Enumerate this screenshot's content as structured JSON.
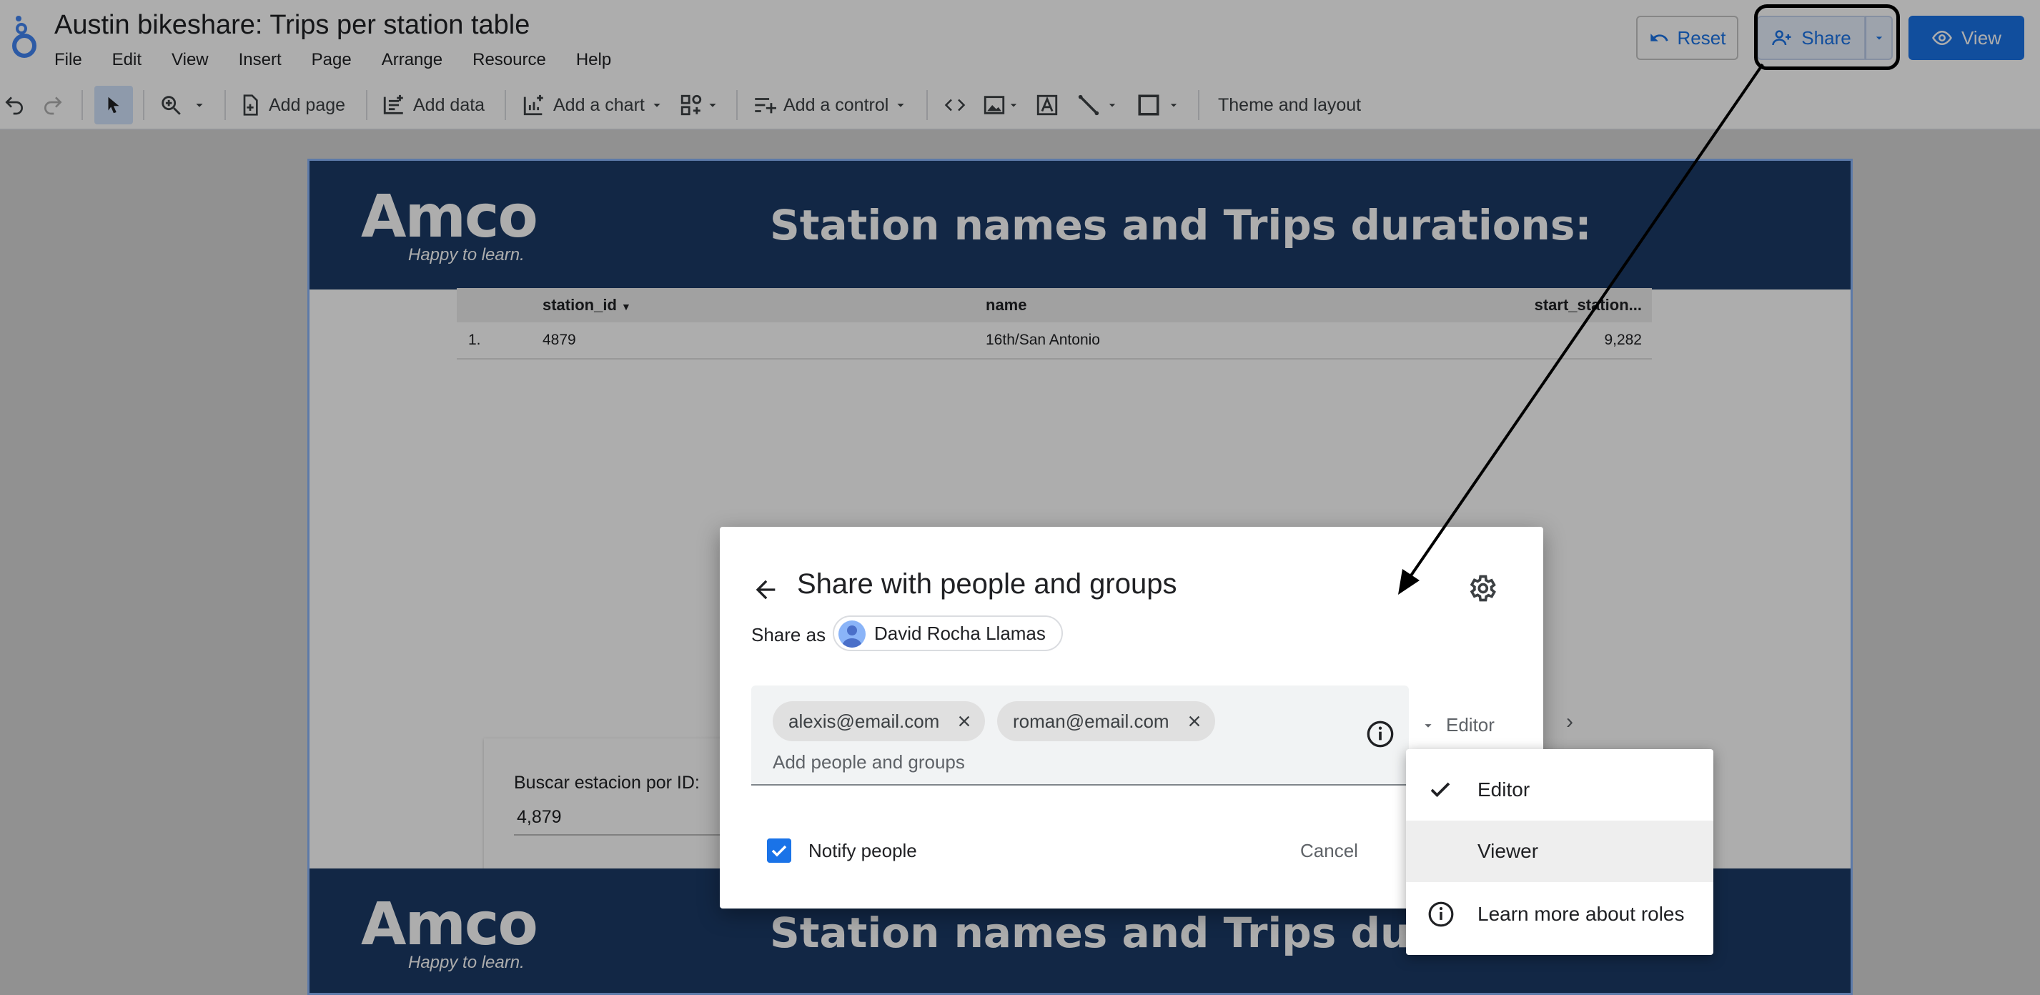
{
  "app": {
    "title": "Austin bikeshare: Trips per station table",
    "menu": [
      "File",
      "Edit",
      "View",
      "Insert",
      "Page",
      "Arrange",
      "Resource",
      "Help"
    ],
    "buttons": {
      "reset": "Reset",
      "share": "Share",
      "view": "View"
    }
  },
  "toolbar": {
    "add_page": "Add page",
    "add_data": "Add data",
    "add_chart": "Add a chart",
    "add_control": "Add a control",
    "theme": "Theme and layout"
  },
  "report": {
    "logo_word": "Amco",
    "logo_tag": "Happy to learn.",
    "banner_title": "Station names and Trips durations:",
    "table": {
      "headers": [
        "station_id",
        "name",
        "start_station..."
      ],
      "rows": [
        {
          "idx": "1.",
          "station_id": "4879",
          "name": "16th/San Antonio",
          "start": "9,282"
        }
      ]
    },
    "search": {
      "label": "Buscar estacion por ID:",
      "value": "4,879"
    }
  },
  "dialog": {
    "title": "Share with people and groups",
    "share_as_label": "Share as",
    "user": "David Rocha Llamas",
    "chips": [
      "alexis@email.com",
      "roman@email.com"
    ],
    "placeholder": "Add people and groups",
    "role": "Editor",
    "notify": "Notify people",
    "cancel": "Cancel"
  },
  "role_menu": {
    "items": [
      "Editor",
      "Viewer",
      "Learn more about roles"
    ],
    "selected": "Editor",
    "hovered": "Viewer"
  },
  "colors": {
    "accent": "#1a73e8",
    "banner": "#1b3a66",
    "annotation": "#000000"
  }
}
